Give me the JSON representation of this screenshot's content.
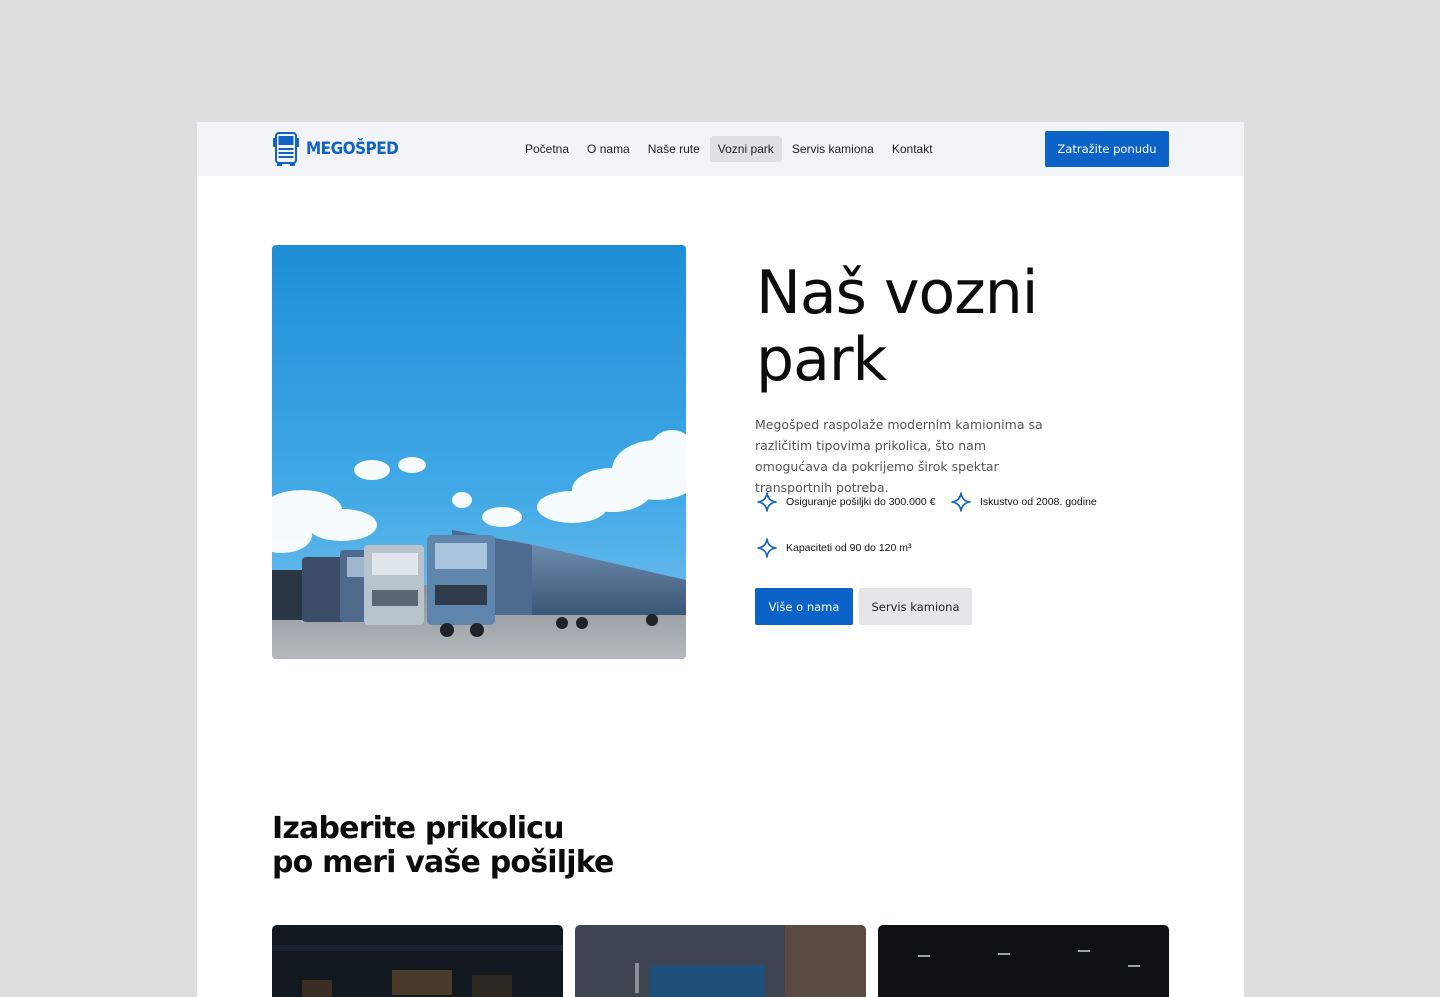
{
  "brand": {
    "name": "MEGOŠPED",
    "accent": "#0b63c7"
  },
  "nav": {
    "items": [
      {
        "label": "Početna"
      },
      {
        "label": "O nama"
      },
      {
        "label": "Naše rute"
      },
      {
        "label": "Vozni park",
        "active": true
      },
      {
        "label": "Servis kamiona"
      },
      {
        "label": "Kontakt"
      }
    ],
    "cta_label": "Zatražite ponudu"
  },
  "hero": {
    "title_line1": "Naš vozni",
    "title_line2": "park",
    "description": "Megošped raspolaže modernim kamionima sa različitim tipovima prikolica, što nam omogućava da pokrijemo širok spektar transportnih potreba.",
    "features": [
      {
        "icon": "sparkle-icon",
        "text": "Osiguranje pošiljki do 300.000 €"
      },
      {
        "icon": "sparkle-icon",
        "text": "Iskustvo od 2008. godine"
      },
      {
        "icon": "sparkle-icon",
        "text": "Kapaciteti od 90 do 120 m³"
      }
    ],
    "primary_button": "Više o nama",
    "secondary_button": "Servis kamiona"
  },
  "trailers": {
    "title_line1": "Izaberite prikolicu",
    "title_line2": "po meri vaše pošiljke"
  }
}
